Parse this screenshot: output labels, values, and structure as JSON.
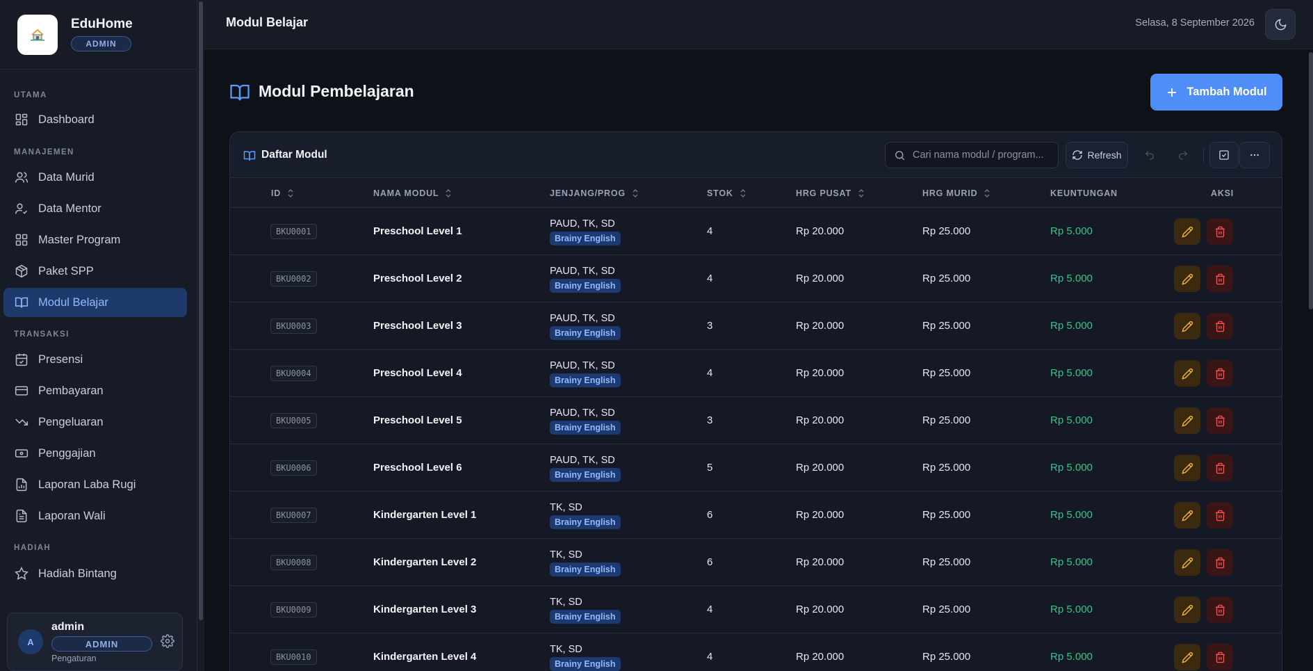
{
  "app": {
    "name": "EduHome",
    "role_badge": "ADMIN"
  },
  "sidebar": {
    "sections": [
      {
        "label": "UTAMA",
        "items": [
          {
            "label": "Dashboard",
            "icon": "dashboard-icon"
          }
        ]
      },
      {
        "label": "MANAJEMEN",
        "items": [
          {
            "label": "Data Murid",
            "icon": "users-icon"
          },
          {
            "label": "Data Mentor",
            "icon": "user-check-icon"
          },
          {
            "label": "Master Program",
            "icon": "grid-icon"
          },
          {
            "label": "Paket SPP",
            "icon": "package-icon"
          },
          {
            "label": "Modul Belajar",
            "icon": "book-open-icon",
            "active": true
          }
        ]
      },
      {
        "label": "TRANSAKSI",
        "items": [
          {
            "label": "Presensi",
            "icon": "calendar-check-icon"
          },
          {
            "label": "Pembayaran",
            "icon": "credit-card-icon"
          },
          {
            "label": "Pengeluaran",
            "icon": "trending-down-icon"
          },
          {
            "label": "Penggajian",
            "icon": "banknote-icon"
          },
          {
            "label": "Laporan Laba Rugi",
            "icon": "file-chart-icon"
          },
          {
            "label": "Laporan Wali",
            "icon": "file-text-icon"
          }
        ]
      },
      {
        "label": "HADIAH",
        "items": [
          {
            "label": "Hadiah Bintang",
            "icon": "star-icon"
          }
        ]
      }
    ],
    "user": {
      "initial": "A",
      "name": "admin",
      "role": "ADMIN",
      "settings_label": "Pengaturan"
    }
  },
  "topbar": {
    "title": "Modul Belajar",
    "date": "Selasa, 8 September 2026"
  },
  "page": {
    "title": "Modul Pembelajaran",
    "add_button": "Tambah Modul"
  },
  "table": {
    "title": "Daftar Modul",
    "search_placeholder": "Cari nama modul / program...",
    "refresh_label": "Refresh",
    "columns": {
      "id": "ID",
      "name": "NAMA MODUL",
      "level": "JENJANG/PROG",
      "stock": "STOK",
      "central_price": "HRG PUSAT",
      "student_price": "HRG MURID",
      "profit": "KEUNTUNGAN",
      "actions": "AKSI"
    },
    "rows": [
      {
        "id": "BKU0001",
        "name": "Preschool Level 1",
        "levels": "PAUD, TK, SD",
        "program": "Brainy English",
        "stock": "4",
        "central_price": "Rp 20.000",
        "student_price": "Rp 25.000",
        "profit": "Rp 5.000"
      },
      {
        "id": "BKU0002",
        "name": "Preschool Level 2",
        "levels": "PAUD, TK, SD",
        "program": "Brainy English",
        "stock": "4",
        "central_price": "Rp 20.000",
        "student_price": "Rp 25.000",
        "profit": "Rp 5.000"
      },
      {
        "id": "BKU0003",
        "name": "Preschool Level 3",
        "levels": "PAUD, TK, SD",
        "program": "Brainy English",
        "stock": "3",
        "central_price": "Rp 20.000",
        "student_price": "Rp 25.000",
        "profit": "Rp 5.000"
      },
      {
        "id": "BKU0004",
        "name": "Preschool Level 4",
        "levels": "PAUD, TK, SD",
        "program": "Brainy English",
        "stock": "4",
        "central_price": "Rp 20.000",
        "student_price": "Rp 25.000",
        "profit": "Rp 5.000"
      },
      {
        "id": "BKU0005",
        "name": "Preschool Level 5",
        "levels": "PAUD, TK, SD",
        "program": "Brainy English",
        "stock": "3",
        "central_price": "Rp 20.000",
        "student_price": "Rp 25.000",
        "profit": "Rp 5.000"
      },
      {
        "id": "BKU0006",
        "name": "Preschool Level 6",
        "levels": "PAUD, TK, SD",
        "program": "Brainy English",
        "stock": "5",
        "central_price": "Rp 20.000",
        "student_price": "Rp 25.000",
        "profit": "Rp 5.000"
      },
      {
        "id": "BKU0007",
        "name": "Kindergarten Level 1",
        "levels": "TK, SD",
        "program": "Brainy English",
        "stock": "6",
        "central_price": "Rp 20.000",
        "student_price": "Rp 25.000",
        "profit": "Rp 5.000"
      },
      {
        "id": "BKU0008",
        "name": "Kindergarten Level 2",
        "levels": "TK, SD",
        "program": "Brainy English",
        "stock": "6",
        "central_price": "Rp 20.000",
        "student_price": "Rp 25.000",
        "profit": "Rp 5.000"
      },
      {
        "id": "BKU0009",
        "name": "Kindergarten Level 3",
        "levels": "TK, SD",
        "program": "Brainy English",
        "stock": "4",
        "central_price": "Rp 20.000",
        "student_price": "Rp 25.000",
        "profit": "Rp 5.000"
      },
      {
        "id": "BKU0010",
        "name": "Kindergarten Level 4",
        "levels": "TK, SD",
        "program": "Brainy English",
        "stock": "4",
        "central_price": "Rp 20.000",
        "student_price": "Rp 25.000",
        "profit": "Rp 5.000"
      }
    ]
  },
  "colors": {
    "accent": "#4f8ef7",
    "profit": "#34c48b",
    "edit": "#f5b53a",
    "delete": "#f05252",
    "background": "#0e1117"
  }
}
